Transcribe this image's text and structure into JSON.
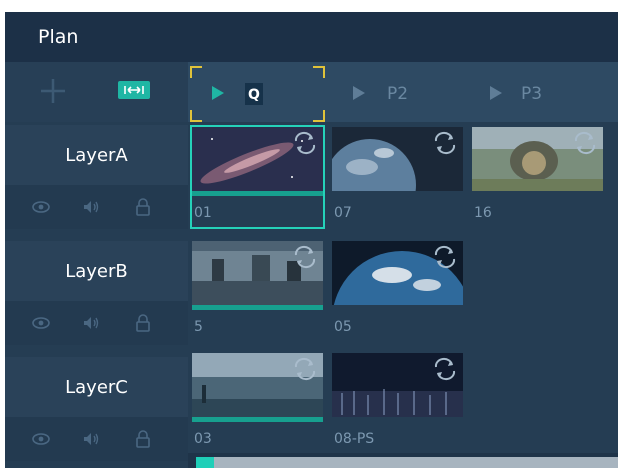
{
  "app": {
    "title": "Plan",
    "colors": {
      "background": "#253d53",
      "accent": "#1fb6a4",
      "selection": "#25d2b9",
      "marker": "#e0c33a"
    }
  },
  "toolbar": {
    "icons": [
      "add-icon",
      "fit-icon"
    ]
  },
  "tabs": [
    {
      "label": "Q",
      "active": true
    },
    {
      "label": "P2",
      "active": false
    },
    {
      "label": "P3",
      "active": false
    }
  ],
  "layers": [
    {
      "name": "LayerA",
      "controls": [
        "eye-icon",
        "speaker-icon",
        "lock-icon"
      ],
      "clips": [
        {
          "label": "01",
          "selected": true
        },
        {
          "label": "07"
        },
        {
          "label": "16"
        }
      ]
    },
    {
      "name": "LayerB",
      "controls": [
        "eye-icon",
        "speaker-icon",
        "lock-icon"
      ],
      "clips": [
        {
          "label": "5"
        },
        {
          "label": "05"
        }
      ]
    },
    {
      "name": "LayerC",
      "controls": [
        "eye-icon",
        "speaker-icon",
        "lock-icon"
      ],
      "clips": [
        {
          "label": "03"
        },
        {
          "label": "08-PS"
        }
      ]
    }
  ]
}
